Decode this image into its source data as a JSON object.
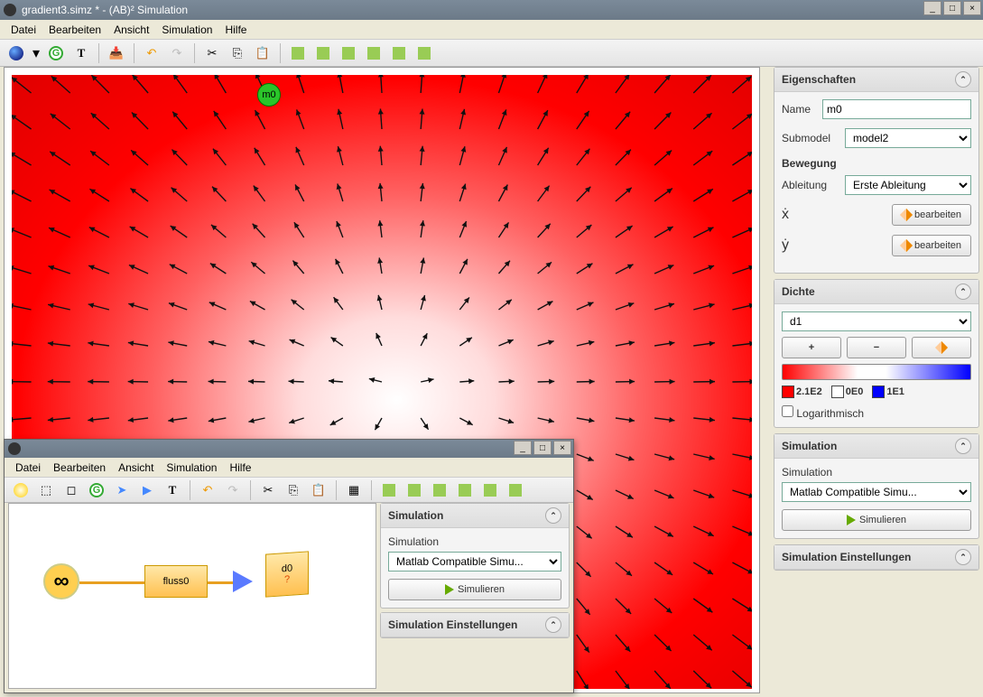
{
  "window": {
    "title": "gradient3.simz * - (AB)² Simulation"
  },
  "menu": {
    "items": [
      "Datei",
      "Bearbeiten",
      "Ansicht",
      "Simulation",
      "Hilfe"
    ]
  },
  "canvas": {
    "node_label": "m0"
  },
  "props": {
    "title": "Eigenschaften",
    "name_label": "Name",
    "name_value": "m0",
    "submodel_label": "Submodel",
    "submodel_value": "model2",
    "movement_title": "Bewegung",
    "derivative_label": "Ableitung",
    "derivative_value": "Erste Ableitung",
    "xdot": "ẋ",
    "ydot": "ẏ",
    "edit_label": "bearbeiten"
  },
  "density": {
    "title": "Dichte",
    "selected": "d1",
    "legend_red": "2.1E2",
    "legend_white": "0E0",
    "legend_blue": "1E1",
    "log_label": "Logarithmisch"
  },
  "simulation": {
    "title": "Simulation",
    "label": "Simulation",
    "engine": "Matlab Compatible Simu...",
    "run_label": "Simulieren",
    "settings_title": "Simulation Einstellungen"
  },
  "subwin": {
    "flow_label": "fluss0",
    "cube_label": "d0",
    "cube_q": "?"
  }
}
